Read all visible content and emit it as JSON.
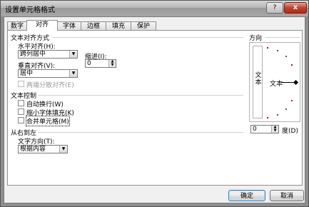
{
  "window": {
    "title": "设置单元格格式",
    "help_glyph": "?",
    "close_glyph": "x"
  },
  "tabs": [
    {
      "label": "数字",
      "active": false
    },
    {
      "label": "对齐",
      "active": true
    },
    {
      "label": "字体",
      "active": false
    },
    {
      "label": "边框",
      "active": false
    },
    {
      "label": "填充",
      "active": false
    },
    {
      "label": "保护",
      "active": false
    }
  ],
  "text_alignment": {
    "section_title": "文本对齐方式",
    "horizontal_label": "水平对齐(H):",
    "horizontal_value": "跨列居中",
    "indent_label": "缩进(I):",
    "indent_value": "0",
    "vertical_label": "垂直对齐(V):",
    "vertical_value": "居中",
    "justify_distributed_label": "两端分散对齐(E)",
    "justify_distributed_enabled": false
  },
  "text_control": {
    "section_title": "文本控制",
    "wrap_text_label": "自动换行(W)",
    "shrink_to_fit_label": "缩小字体填充(K)",
    "merge_cells_label": "合并单元格(M)"
  },
  "rtl": {
    "section_title": "从右到左",
    "direction_label": "文字方向(T):",
    "direction_value": "根据内容"
  },
  "orientation": {
    "section_title": "方向",
    "vertical_text": "文本",
    "dial_text": "文本",
    "degree_value": "0",
    "degree_label": "度(D)"
  },
  "buttons": {
    "ok": "确定",
    "cancel": "取消"
  },
  "icons": {
    "arrow": "▼",
    "spin_up": "▲",
    "spin_down": "▼",
    "grip": "⋰"
  }
}
